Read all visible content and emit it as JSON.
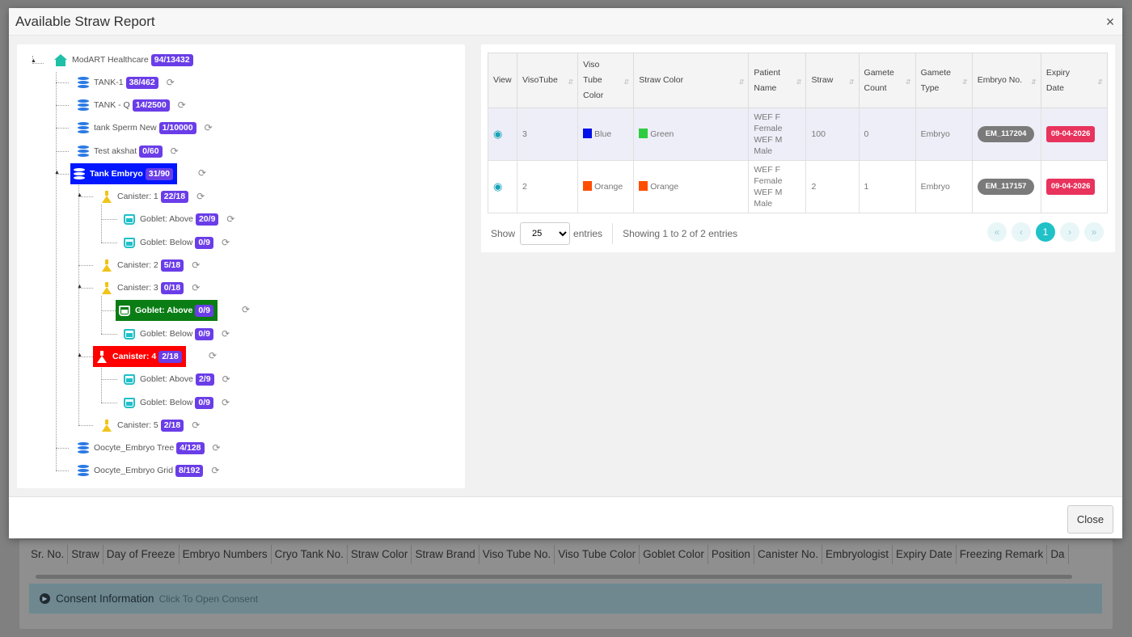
{
  "background": {
    "columns": [
      "Sr. No.",
      "Straw",
      "Day of Freeze",
      "Embryo Numbers",
      "Cryo Tank No.",
      "Straw Color",
      "Straw Brand",
      "Viso Tube No.",
      "Viso Tube Color",
      "Goblet Color",
      "Position",
      "Canister No.",
      "Embryologist",
      "Expiry Date",
      "Freezing Remark",
      "Da"
    ],
    "consent_title": "Consent Information",
    "consent_hint": "Click To Open Consent"
  },
  "modal": {
    "title": "Available Straw Report",
    "close_label": "Close"
  },
  "tree": {
    "root": {
      "label": "ModART Healthcare",
      "count": "94/13432"
    },
    "tanks": [
      {
        "label": "TANK-1",
        "count": "38/462"
      },
      {
        "label": "TANK - Q",
        "count": "14/2500"
      },
      {
        "label": "tank Sperm New",
        "count": "1/10000"
      },
      {
        "label": "Test akshat",
        "count": "0/60"
      },
      {
        "label": "Tank Embryo",
        "count": "31/90"
      },
      {
        "label": "Oocyte_Embryo Tree",
        "count": "4/128"
      },
      {
        "label": "Oocyte_Embryo Grid",
        "count": "8/192"
      }
    ],
    "canisters": [
      {
        "label": "Canister: 1",
        "count": "22/18"
      },
      {
        "label": "Canister: 2",
        "count": "5/18"
      },
      {
        "label": "Canister: 3",
        "count": "0/18"
      },
      {
        "label": "Canister: 4",
        "count": "2/18"
      },
      {
        "label": "Canister: 5",
        "count": "2/18"
      }
    ],
    "goblets": [
      {
        "label": "Goblet: Above",
        "count": "20/9"
      },
      {
        "label": "Goblet: Below",
        "count": "0/9"
      },
      {
        "label": "Goblet: Above",
        "count": "0/9"
      },
      {
        "label": "Goblet: Below",
        "count": "0/9"
      },
      {
        "label": "Goblet: Above",
        "count": "2/9"
      },
      {
        "label": "Goblet: Below",
        "count": "0/9"
      }
    ]
  },
  "table": {
    "headers": [
      "View",
      "VisoTube",
      "Viso Tube Color",
      "Straw Color",
      "Patient Name",
      "Straw",
      "Gamete Count",
      "Gamete Type",
      "Embryo No.",
      "Expiry Date"
    ],
    "rows": [
      {
        "visotube": "3",
        "viso_color": "Blue",
        "viso_hex": "#0010e8",
        "straw_color": "Green",
        "straw_hex": "#2ecc40",
        "patient": "WEF F Female WEF M Male",
        "straw": "100",
        "gamete_count": "0",
        "gamete_type": "Embryo",
        "embryo_no": "EM_117204",
        "expiry": "09-04-2026"
      },
      {
        "visotube": "2",
        "viso_color": "Orange",
        "viso_hex": "#ff4d00",
        "straw_color": "Orange",
        "straw_hex": "#ff4d00",
        "patient": "WEF F Female WEF M Male",
        "straw": "2",
        "gamete_count": "1",
        "gamete_type": "Embryo",
        "embryo_no": "EM_117157",
        "expiry": "09-04-2026"
      }
    ],
    "show_label": "Show",
    "page_size": "25",
    "entries_label": "entries",
    "info": "Showing 1 to 2 of 2 entries",
    "current_page": "1"
  }
}
